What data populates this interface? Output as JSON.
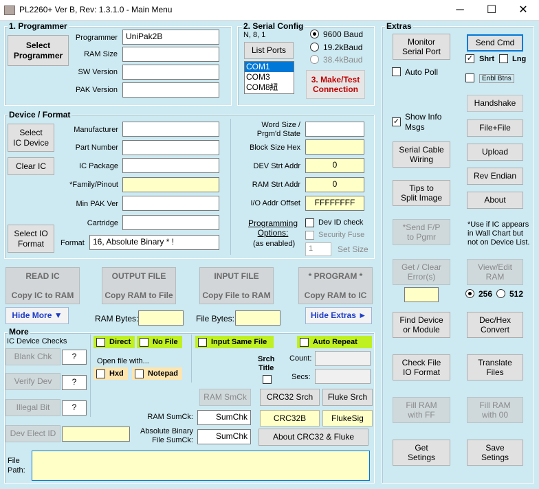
{
  "window": {
    "title": "PL2260+ Ver B, Rev: 1.3.1.0 - Main Menu",
    "minimize": "─",
    "maximize": "☐",
    "close": "✕"
  },
  "programmer": {
    "title": "1. Programmer",
    "select_button": "Select\nProgrammer",
    "fields": [
      {
        "label": "Programmer",
        "value": "UniPak2B"
      },
      {
        "label": "RAM Size",
        "value": ""
      },
      {
        "label": "SW Version",
        "value": ""
      },
      {
        "label": "PAK Version",
        "value": ""
      }
    ]
  },
  "serial": {
    "title": "2. Serial Config",
    "params": "N, 8, 1",
    "list_ports": "List Ports",
    "ports": [
      "COM1",
      "COM3",
      "COM8紐"
    ],
    "bauds": [
      "9600 Baud",
      "19.2kBaud",
      "38.4kBaud"
    ],
    "selected_baud": "9600 Baud",
    "connect_button": "3. Make/Test\nConnection"
  },
  "device": {
    "title": "Device / Format",
    "select_ic": "Select\nIC Device",
    "clear_ic": "Clear IC",
    "select_io": "Select IO\nFormat",
    "fields": [
      {
        "label": "Manufacturer",
        "value": ""
      },
      {
        "label": "Part Number",
        "value": ""
      },
      {
        "label": "IC Package",
        "value": ""
      },
      {
        "label": "*Family/Pinout",
        "value": ""
      },
      {
        "label": "Min PAK Ver",
        "value": ""
      },
      {
        "label": "Cartridge",
        "value": ""
      }
    ],
    "format_label": "Format",
    "format_value": "16, Absolute Binary * !",
    "right_fields": [
      {
        "label": "Word Size /\nPrgm'd State",
        "value": ""
      },
      {
        "label": "Block Size Hex",
        "value": ""
      },
      {
        "label": "DEV Strt Addr",
        "value": "0"
      },
      {
        "label": "RAM Strt Addr",
        "value": "0"
      },
      {
        "label": "I/O Addr Offset",
        "value": "FFFFFFFF"
      }
    ],
    "prog_options_label": "Programming\nOptions:",
    "prog_options_note": "(as enabled)",
    "dev_id_check": "Dev ID check",
    "security_fuse": "Security Fuse",
    "set_size_value": "1",
    "set_size_label": "Set Size"
  },
  "actions": {
    "read_ic": {
      "top": "READ IC",
      "bottom": "Copy IC to RAM"
    },
    "output_file": {
      "top": "OUTPUT FILE",
      "bottom": "Copy RAM to File"
    },
    "input_file": {
      "top": "INPUT FILE",
      "bottom": "Copy File to RAM"
    },
    "program": {
      "top": "* PROGRAM *",
      "bottom": "Copy RAM to IC"
    },
    "hide_more": "Hide More ▼",
    "ram_bytes_label": "RAM Bytes:",
    "file_bytes_label": "File Bytes:",
    "hide_extras": "Hide Extras ►"
  },
  "more": {
    "title": "More",
    "ic_checks_label": "IC Device Checks",
    "blank_chk": "Blank Chk",
    "verify_dev": "Verify Dev",
    "illegal_bit": "Illegal Bit",
    "dev_elect_id": "Dev Elect ID",
    "q": "?",
    "direct": "Direct",
    "no_file": "No File",
    "input_same_file": "Input Same File",
    "auto_repeat": "Auto Repeat",
    "open_file_with": "Open file with...",
    "hxd": "Hxd",
    "notepad": "Notepad",
    "srch_title": "Srch\nTitle",
    "count_label": "Count:",
    "secs_label": "Secs:",
    "ram_smck": "RAM SmCk",
    "crc32_srch": "CRC32 Srch",
    "fluke_srch": "Fluke Srch",
    "ram_sumck_label": "RAM SumCk:",
    "sumchk": "SumChk",
    "crc32b": "CRC32B",
    "flukesig": "FlukeSig",
    "abs_bin_label": "Absolute Binary\nFile SumCk:",
    "about_crc": "About CRC32 & Fluke",
    "file_path_label": "File\nPath:",
    "file_path_value": ""
  },
  "extras": {
    "title": "Extras",
    "monitor": "Monitor\nSerial Port",
    "auto_poll": "Auto Poll",
    "send_cmd": "Send Cmd",
    "shrt": "Shrt",
    "lng": "Lng",
    "enbl_btns": "Enbl Btns",
    "handshake": "Handshake",
    "show_info": "Show Info\nMsgs",
    "file_file": "File+File",
    "serial_cable": "Serial Cable\nWiring",
    "upload": "Upload",
    "rev_endian": "Rev Endian",
    "tips": "Tips to\nSplit Image",
    "about": "About",
    "send_fp": "*Send F/P\nto Pgmr",
    "use_note": "*Use if IC appears\nin Wall Chart but\nnot on Device List.",
    "get_clear_error": "Get / Clear\nError(s)",
    "view_edit_ram": "View/Edit\nRAM",
    "r256": "256",
    "r512": "512",
    "find_device": "Find Device\nor Module",
    "dec_hex": "Dec/Hex\nConvert",
    "check_file": "Check File\nIO Format",
    "translate": "Translate\nFiles",
    "fill_ff": "Fill RAM\nwith FF",
    "fill_00": "Fill RAM\nwith 00",
    "get_settings": "Get\nSetings",
    "save_settings": "Save\nSetings"
  }
}
